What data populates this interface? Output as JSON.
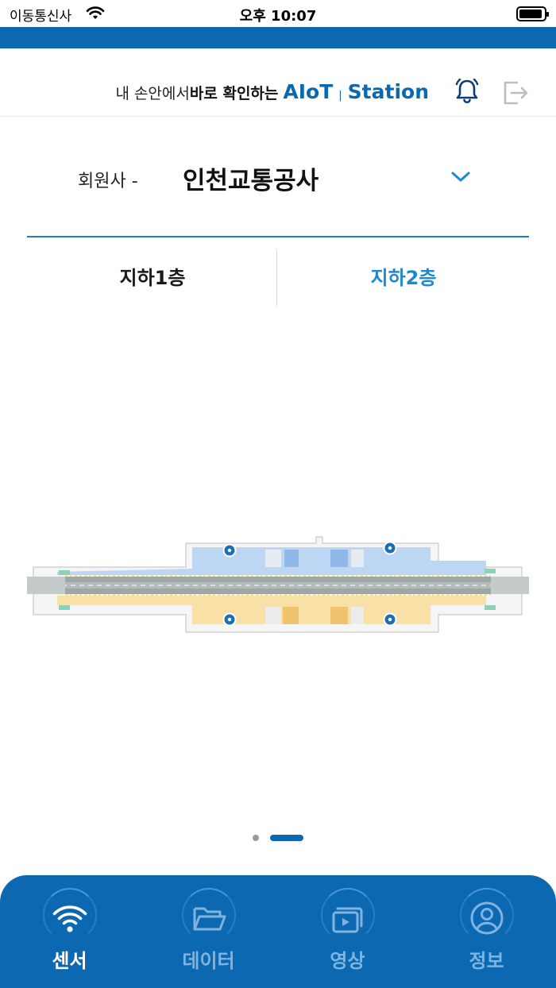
{
  "status_bar": {
    "carrier": "이동통신사",
    "time": "오후 10:07"
  },
  "header": {
    "tagline_prefix": "내 손안에서 ",
    "tagline_bold": "바로 확인하는",
    "brand_left": "AIoT",
    "brand_separator": "|",
    "brand_right": "Station",
    "bell_icon": "bell-icon",
    "logout_icon": "logout-icon"
  },
  "member": {
    "label": "회원사 -",
    "selected": "인천교통공사"
  },
  "floors": {
    "tabs": [
      {
        "label": "지하1층"
      },
      {
        "label": "지하2층"
      }
    ],
    "selected_index": 1
  },
  "pager": {
    "pages": 2,
    "active_index": 1
  },
  "tabbar": {
    "items": [
      {
        "label": "센서",
        "icon": "wifi-icon"
      },
      {
        "label": "데이터",
        "icon": "folder-icon"
      },
      {
        "label": "영상",
        "icon": "video-library-icon"
      },
      {
        "label": "정보",
        "icon": "user-circle-icon"
      }
    ],
    "active_index": 0
  },
  "colors": {
    "primary": "#0c68b0",
    "accent": "#1a8ad2",
    "inactive_tab": "#7fb3e0",
    "zone_blue": "#bcd6f3",
    "zone_yellow": "#f8e0a6",
    "track": "#9ea7a6"
  }
}
